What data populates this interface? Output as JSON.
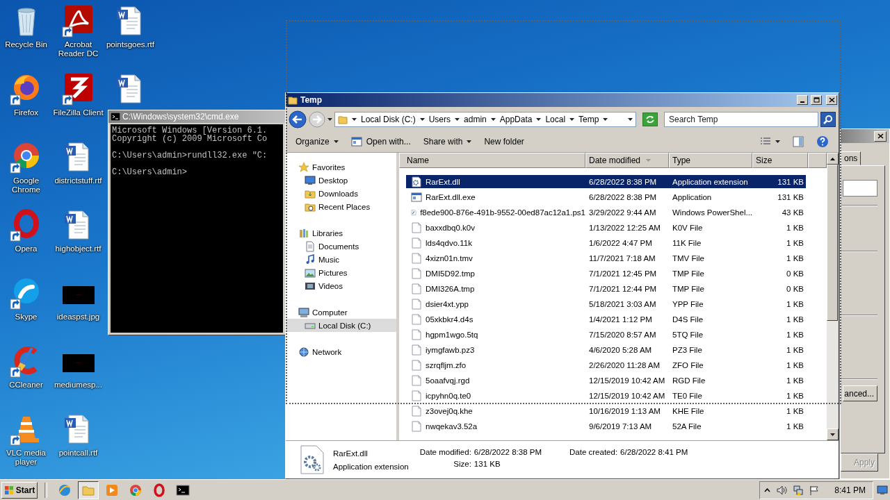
{
  "desktop": {
    "icons": [
      {
        "label": "Recycle Bin",
        "kind": "system"
      },
      {
        "label": "Firefox",
        "kind": "shortcut"
      },
      {
        "label": "Google Chrome",
        "kind": "shortcut"
      },
      {
        "label": "Opera",
        "kind": "shortcut"
      },
      {
        "label": "Skype",
        "kind": "shortcut"
      },
      {
        "label": "CCleaner",
        "kind": "shortcut"
      },
      {
        "label": "VLC media player",
        "kind": "shortcut"
      },
      {
        "label": "Acrobat Reader DC",
        "kind": "shortcut"
      },
      {
        "label": "FileZilla Client",
        "kind": "shortcut"
      },
      {
        "label": "districtstuff.rtf",
        "kind": "document"
      },
      {
        "label": "highobject.rtf",
        "kind": "document"
      },
      {
        "label": "ideaspst.jpg",
        "kind": "image"
      },
      {
        "label": "mediumesp...",
        "kind": "image"
      },
      {
        "label": "pointcall.rtf",
        "kind": "document"
      },
      {
        "label": "pointsgoes.rtf",
        "kind": "document"
      },
      {
        "kind": "document"
      }
    ]
  },
  "cmd_window": {
    "title": "C:\\Windows\\system32\\cmd.exe",
    "paragraphs": [
      [
        "Microsoft Windows [Version 6.1.",
        "Copyright (c) 2009 Microsoft Co"
      ],
      [
        "C:\\Users\\admin>rundll32.exe \"C:"
      ],
      [
        "C:\\Users\\admin>"
      ]
    ]
  },
  "dialog": {
    "tab": "ons",
    "buttons": [
      {
        "label": "anced...",
        "disabled": false
      },
      {
        "label": "Apply",
        "disabled": true
      }
    ]
  },
  "explorer": {
    "title": "Temp",
    "breadcrumb": [
      "Local Disk (C:)",
      "Users",
      "admin",
      "AppData",
      "Local",
      "Temp"
    ],
    "search": {
      "placeholder": "Search Temp"
    },
    "toolbar": [
      {
        "label": "Organize",
        "kind": "menu"
      },
      {
        "label": "Open with...",
        "kind": "icon"
      },
      {
        "label": "Share with",
        "kind": "menu"
      },
      {
        "label": "New folder",
        "kind": "plain"
      }
    ],
    "navigation": [
      {
        "label": "Favorites",
        "selected": false,
        "children": [
          {
            "label": "Desktop",
            "selected": false
          },
          {
            "label": "Downloads",
            "selected": false
          },
          {
            "label": "Recent Places",
            "selected": false
          }
        ]
      },
      {
        "label": "Libraries",
        "selected": false,
        "children": [
          {
            "label": "Documents",
            "selected": false
          },
          {
            "label": "Music",
            "selected": false
          },
          {
            "label": "Pictures",
            "selected": false
          },
          {
            "label": "Videos",
            "selected": false
          }
        ]
      },
      {
        "label": "Computer",
        "selected": false,
        "children": [
          {
            "label": "Local Disk (C:)",
            "selected": true
          }
        ]
      },
      {
        "label": "Network",
        "selected": false
      }
    ],
    "columns": [
      {
        "label": "Name",
        "sorted": false
      },
      {
        "label": "Date modified",
        "sorted": true
      },
      {
        "label": "Type",
        "sorted": false
      },
      {
        "label": "Size",
        "sorted": false
      }
    ],
    "rows": [
      {
        "name": "RarExt.dll",
        "date": "6/28/2022 8:38 PM",
        "type": "Application extension",
        "size": "131 KB",
        "kind": "extension",
        "selected": true
      },
      {
        "name": "RarExt.dll.exe",
        "date": "6/28/2022 8:38 PM",
        "type": "Application",
        "size": "131 KB",
        "kind": "application",
        "selected": false
      },
      {
        "name": "f8ede900-876e-491b-9552-00ed87ac12a1.ps1",
        "date": "3/29/2022 9:44 AM",
        "type": "Windows PowerShel...",
        "size": "43 KB",
        "kind": "script",
        "selected": false
      },
      {
        "name": "baxxdbq0.k0v",
        "date": "1/13/2022 12:25 AM",
        "type": "K0V File",
        "size": "1 KB",
        "kind": "file",
        "selected": false
      },
      {
        "name": "lds4qdvo.11k",
        "date": "1/6/2022 4:47 PM",
        "type": "11K File",
        "size": "1 KB",
        "kind": "file",
        "selected": false
      },
      {
        "name": "4xizn01n.tmv",
        "date": "11/7/2021 7:18 AM",
        "type": "TMV File",
        "size": "1 KB",
        "kind": "file",
        "selected": false
      },
      {
        "name": "DMI5D92.tmp",
        "date": "7/1/2021 12:45 PM",
        "type": "TMP File",
        "size": "0 KB",
        "kind": "file",
        "selected": false
      },
      {
        "name": "DMI326A.tmp",
        "date": "7/1/2021 12:44 PM",
        "type": "TMP File",
        "size": "0 KB",
        "kind": "file",
        "selected": false
      },
      {
        "name": "dsier4xt.ypp",
        "date": "5/18/2021 3:03 AM",
        "type": "YPP File",
        "size": "1 KB",
        "kind": "file",
        "selected": false
      },
      {
        "name": "05xkbkr4.d4s",
        "date": "1/4/2021 1:12 PM",
        "type": "D4S File",
        "size": "1 KB",
        "kind": "file",
        "selected": false
      },
      {
        "name": "hgpm1wgo.5tq",
        "date": "7/15/2020 8:57 AM",
        "type": "5TQ File",
        "size": "1 KB",
        "kind": "file",
        "selected": false
      },
      {
        "name": "iymgfawb.pz3",
        "date": "4/6/2020 5:28 AM",
        "type": "PZ3 File",
        "size": "1 KB",
        "kind": "file",
        "selected": false
      },
      {
        "name": "szrqfljm.zfo",
        "date": "2/26/2020 11:28 AM",
        "type": "ZFO File",
        "size": "1 KB",
        "kind": "file",
        "selected": false
      },
      {
        "name": "5oaafvqj.rgd",
        "date": "12/15/2019 10:42 AM",
        "type": "RGD File",
        "size": "1 KB",
        "kind": "file",
        "selected": false
      },
      {
        "name": "icpyhn0q.te0",
        "date": "12/15/2019 10:42 AM",
        "type": "TE0 File",
        "size": "1 KB",
        "kind": "file",
        "selected": false
      },
      {
        "name": "z3ovej0q.khe",
        "date": "10/16/2019 1:13 AM",
        "type": "KHE File",
        "size": "1 KB",
        "kind": "file",
        "selected": false
      },
      {
        "name": "nwqekav3.52a",
        "date": "9/6/2019 7:13 AM",
        "type": "52A File",
        "size": "1 KB",
        "kind": "file",
        "selected": false
      }
    ],
    "details": {
      "name": "RarExt.dll",
      "type": "Application extension",
      "fields": [
        {
          "label": "Date modified:",
          "value": "6/28/2022 8:38 PM"
        },
        {
          "label": "Size:",
          "value": "131 KB"
        },
        {
          "label": "Date created:",
          "value": "6/28/2022 8:41 PM"
        }
      ]
    }
  },
  "taskbar": {
    "start": "Start",
    "apps": [
      {
        "active": false
      },
      {
        "active": true
      },
      {
        "active": false
      },
      {
        "active": false
      },
      {
        "active": false
      },
      {
        "active": false
      }
    ],
    "clock": "8:41 PM"
  }
}
